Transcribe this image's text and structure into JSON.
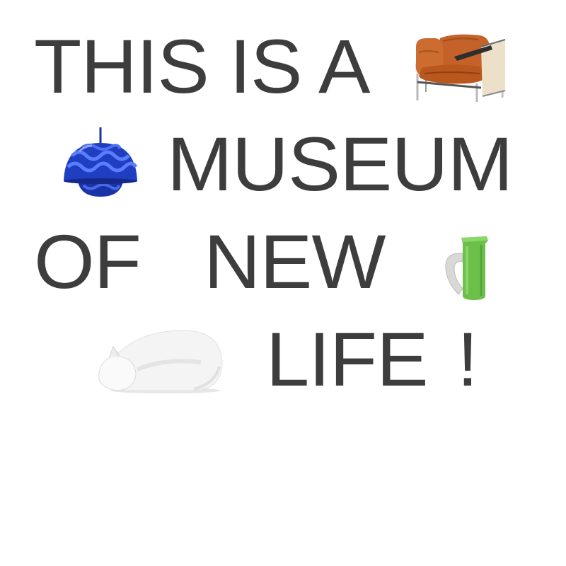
{
  "headline": {
    "line1": "THIS IS A",
    "line2": "MUSEUM",
    "line3a": "OF",
    "line3b": "NEW",
    "line4a": "LIFE",
    "line4b": "!"
  },
  "illustrations": [
    {
      "name": "armchair-icon",
      "depicts": "leather armchair"
    },
    {
      "name": "pendant-lamp-icon",
      "depicts": "blue pendant lamp"
    },
    {
      "name": "jug-icon",
      "depicts": "green glass jug"
    },
    {
      "name": "sleeping-cat-icon",
      "depicts": "white sleeping cat figurine"
    }
  ],
  "colors": {
    "text": "#3d3d3d",
    "background": "#ffffff",
    "chair_leather": "#c8692e",
    "lamp_blue": "#1f3fc0",
    "jug_green": "#66bb44",
    "cat_white": "#f3f3f3"
  }
}
